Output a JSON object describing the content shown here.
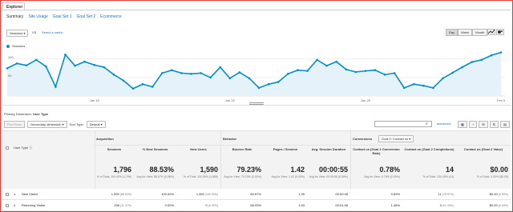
{
  "tabs": {
    "explorer": "Explorer"
  },
  "subnav": [
    "Summary",
    "Site Usage",
    "Goal Set 1",
    "Goal Set 2",
    "Ecommerce"
  ],
  "metric_bar": {
    "metric": "Sessions",
    "vs": "VS.",
    "select_metric": "Select a metric"
  },
  "period_buttons": [
    "Day",
    "Week",
    "Month"
  ],
  "chart_data": {
    "type": "line",
    "series": [
      {
        "name": "Sessions",
        "values": [
          75,
          88,
          83,
          98,
          80,
          25,
          112,
          82,
          93,
          84,
          78,
          58,
          42,
          20,
          32,
          25,
          62,
          70,
          62,
          60,
          62,
          50,
          78,
          48,
          64,
          48,
          22,
          32,
          38,
          60,
          70,
          68,
          98,
          82,
          93,
          72,
          65,
          68,
          70,
          58,
          62,
          22,
          32,
          28,
          22,
          48,
          63,
          78,
          92,
          98,
          110,
          118
        ]
      },
      {
        "name": "",
        "values": []
      }
    ],
    "yticks": [
      "100",
      "50"
    ],
    "ylim": [
      0,
      130
    ],
    "xticks": [
      "Jan 15",
      "Jan 22",
      "Jan 29",
      "Feb 5"
    ],
    "color": "#058dc7"
  },
  "dimension": {
    "label": "Primary Dimension:",
    "value": "User Type"
  },
  "toolbar": {
    "plot_rows": "Plot Rows",
    "secondary": "Secondary dimension",
    "sort_type_label": "Sort Type:",
    "sort_type": "Default",
    "advanced": "advanced"
  },
  "table": {
    "dim_header": "User Type",
    "groups": {
      "acquisition": "Acquisition",
      "behavior": "Behavior",
      "conversions": "Conversions",
      "goal_select": "Goal 2: Contact us"
    },
    "columns": [
      {
        "label": "Sessions",
        "total": "1,796",
        "sub": "% of Total: 100.00% (1,796)"
      },
      {
        "label": "% New Sessions",
        "total": "88.53%",
        "sub": "Avg for View: 88.47% (0.06%)"
      },
      {
        "label": "New Users",
        "total": "1,590",
        "sub": "% of Total: 100.06% (1,589)"
      },
      {
        "label": "Bounce Rate",
        "total": "79.23%",
        "sub": "Avg for View: 79.23% (0.00%)"
      },
      {
        "label": "Pages / Session",
        "total": "1.42",
        "sub": "Avg for View: 1.42 (0.00%)"
      },
      {
        "label": "Avg. Session Duration",
        "total": "00:00:55",
        "sub": "Avg for View: 00:00:55 (0.00%)"
      },
      {
        "label": "Contact us (Goal 2 Conversion Rate)",
        "total": "0.78%",
        "sub": "Avg for View: 0.78% (0.00%)"
      },
      {
        "label": "Contact us (Goal 2 Completions)",
        "total": "14",
        "sub": "% of Total: 100.00% (14)"
      },
      {
        "label": "Contact us (Goal 2 Value)",
        "total": "$0.00",
        "sub": "% of Total: 0.00% ($0.00)"
      }
    ],
    "rows": [
      {
        "idx": "1.",
        "name": "New Visitor",
        "cells": [
          "1,590",
          "100.00%",
          "1,590",
          "80.57%",
          "1.39",
          "00:00:48",
          "0.69%",
          "11",
          "$0.00"
        ],
        "pcts": [
          "(88.53%)",
          "",
          "(100.00%)",
          "",
          "",
          "",
          "",
          "(78.57%)",
          "(0.00%)"
        ]
      },
      {
        "idx": "2.",
        "name": "Returning Visitor",
        "cells": [
          "206",
          "0.00%",
          "0",
          "68.93%",
          "1.63",
          "00:01:48",
          "1.46%",
          "3",
          "$0.00"
        ],
        "pcts": [
          "(11.47%)",
          "",
          "(0.00%)",
          "",
          "",
          "",
          "",
          "(21.43%)",
          "(0.00%)"
        ]
      }
    ]
  }
}
